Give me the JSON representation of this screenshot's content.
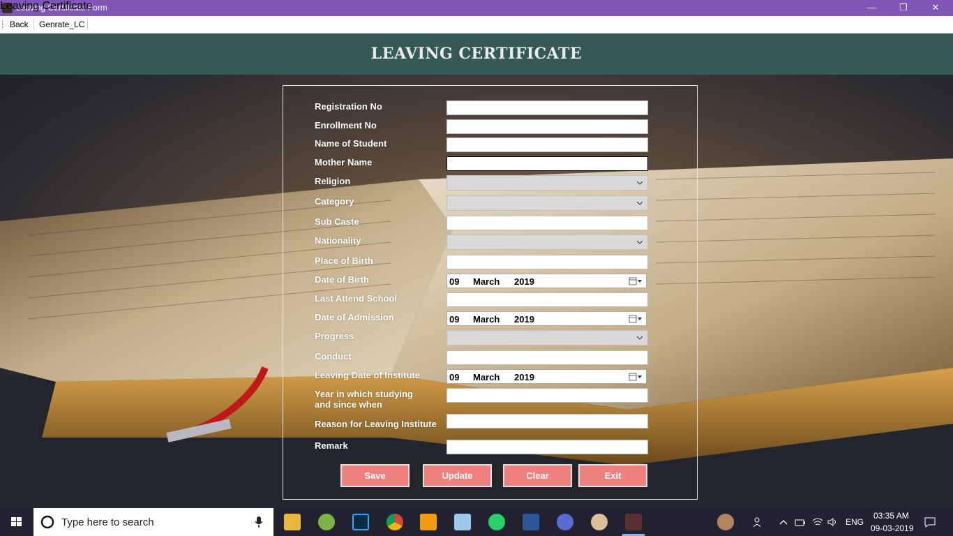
{
  "window": {
    "title": "Leaving Certificate Form",
    "minimize_icon": "minimize-icon",
    "restore_icon": "restore-icon",
    "close_icon": "close-icon"
  },
  "menu": {
    "back": "Back",
    "generate": "Genrate_LC"
  },
  "header": {
    "title": "LEAVING CERTIFICATE"
  },
  "form": {
    "group_label": "Leaving Certificate",
    "fields": {
      "registration_no": "Registration No",
      "enrollment_no": "Enrollment No",
      "name_of_student": "Name of Student",
      "mother_name": "Mother Name",
      "religion": "Religion",
      "category": "Category",
      "sub_caste": "Sub Caste",
      "nationality": "Nationality",
      "place_of_birth": "Place of Birth",
      "date_of_birth": "Date of Birth",
      "last_attend_school": "Last Attend School",
      "date_of_admission": "Date of Admission",
      "progress": "Progress",
      "conduct": "Conduct",
      "leaving_date": "Leaving Date of Institute",
      "year_studying_line1": "Year in which studying",
      "year_studying_line2": "and since when",
      "reason_leaving": "Reason for Leaving Institute",
      "remark": "Remark"
    },
    "dates": {
      "birth": {
        "day": "09",
        "month": "March",
        "year": "2019"
      },
      "admission": {
        "day": "09",
        "month": "March",
        "year": "2019"
      },
      "leaving": {
        "day": "09",
        "month": "March",
        "year": "2019"
      }
    },
    "buttons": {
      "save": "Save",
      "update": "Update",
      "clear": "Clear",
      "exit": "Exit"
    }
  },
  "taskbar": {
    "search_placeholder": "Type here to search",
    "language": "ENG",
    "time": "03:35 AM",
    "date": "09-03-2019"
  }
}
